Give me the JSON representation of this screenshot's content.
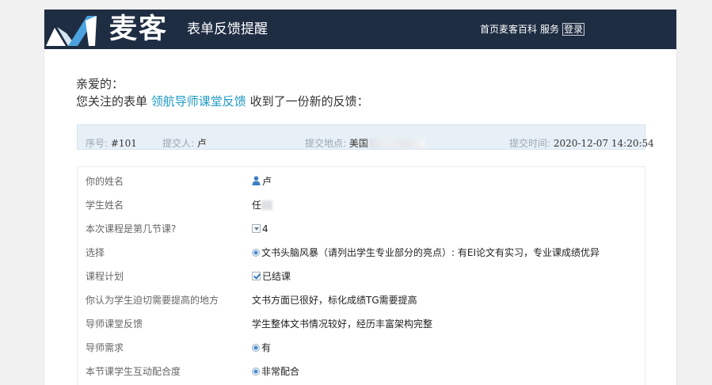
{
  "header": {
    "brand": "麦客",
    "subtitle": "表单反馈提醒",
    "nav": {
      "home": "首页",
      "wiki": "麦客百科",
      "service": "服务",
      "login": "登录"
    }
  },
  "greeting": {
    "salutation": "亲爱的：",
    "prefix": "您关注的表单",
    "form_name": "领航导师课堂反馈",
    "suffix": "收到了一份新的反馈："
  },
  "meta": {
    "serial_label": "序号:",
    "serial_value": "#101",
    "submitter_label": "提交人:",
    "submitter_value": "卢",
    "location_label": "提交地点:",
    "location_value": "美国",
    "time_label": "提交时间:",
    "time_value": "2020-12-07 14:20:54"
  },
  "fields": [
    {
      "label": "你的姓名",
      "icon": "user-icon",
      "value": "卢"
    },
    {
      "label": "学生姓名",
      "icon": "",
      "value": "任"
    },
    {
      "label": "本次课程是第几节课?",
      "icon": "dropdown-icon",
      "value": "4"
    },
    {
      "label": "选择",
      "icon": "radio-icon",
      "value": "文书头脑风暴（请列出学生专业部分的亮点）: 有EI论文有实习，专业课成绩优异"
    },
    {
      "label": "课程计划",
      "icon": "checkbox-icon",
      "value": "已结课"
    },
    {
      "label": "你认为学生迫切需要提高的地方",
      "icon": "",
      "value": "文书方面已很好，标化成绩TG需要提高"
    },
    {
      "label": "导师课堂反馈",
      "icon": "",
      "value": "学生整体文书情况较好，经历丰富架构完整"
    },
    {
      "label": "导师需求",
      "icon": "radio-icon",
      "value": "有"
    },
    {
      "label": "本节课学生互动配合度",
      "icon": "radio-icon",
      "value": "非常配合"
    }
  ],
  "colors": {
    "header_bg": "#1f2d43",
    "link": "#1e9ac4",
    "meta_bg": "#e8f0f7"
  }
}
